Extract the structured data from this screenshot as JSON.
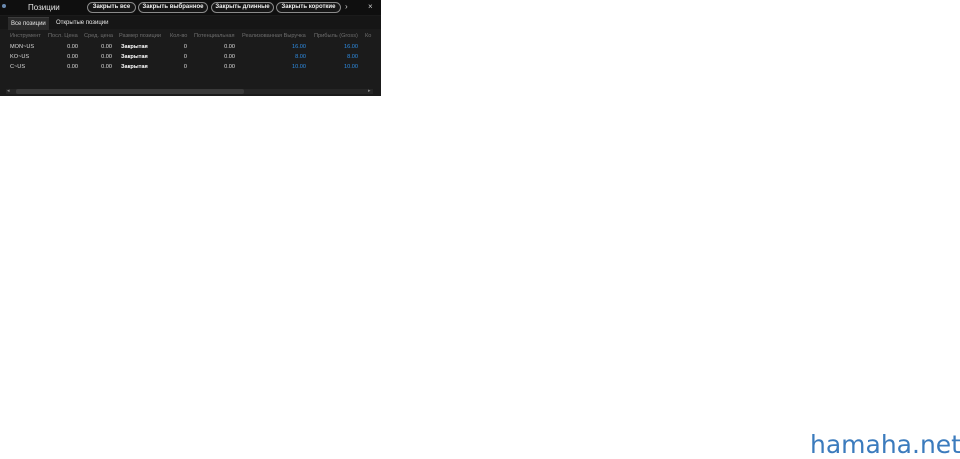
{
  "window": {
    "title": "Позиции",
    "buttons": {
      "close_all": "Закрыть все",
      "close_selected": "Закрыть выбранное",
      "close_long": "Закрыть длинные",
      "close_short": "Закрыть короткие"
    },
    "icons": {
      "more": "›",
      "close": "×"
    }
  },
  "tabs": [
    {
      "label": "Все позиции",
      "active": true
    },
    {
      "label": "Открытые позиции",
      "active": false
    }
  ],
  "table": {
    "columns": [
      "Инструмент",
      "Посл. Цена",
      "Сред. цена",
      "Размер позиции",
      "Кол-во",
      "Потенциальная",
      "Реализованная Выручка",
      "Прибыль (Gross)",
      "Ко"
    ],
    "rows": [
      {
        "instrument": "MON~US",
        "last_price": "0.00",
        "avg_price": "0.00",
        "position_size": "Закрытая",
        "qty": "0",
        "potential": "0.00",
        "realized": "16.00",
        "profit": "16.00"
      },
      {
        "instrument": "KO~US",
        "last_price": "0.00",
        "avg_price": "0.00",
        "position_size": "Закрытая",
        "qty": "0",
        "potential": "0.00",
        "realized": "8.00",
        "profit": "8.00"
      },
      {
        "instrument": "C~US",
        "last_price": "0.00",
        "avg_price": "0.00",
        "position_size": "Закрытая",
        "qty": "0",
        "potential": "0.00",
        "realized": "10.00",
        "profit": "10.00"
      }
    ]
  },
  "scrollbar": {
    "left_arrow": "◂",
    "right_arrow": "▸"
  },
  "watermark": "hamaha.net",
  "colors": {
    "panel_bg": "#1b1b1b",
    "accent_blue": "#2f8de4",
    "watermark": "#3b7bbd"
  }
}
